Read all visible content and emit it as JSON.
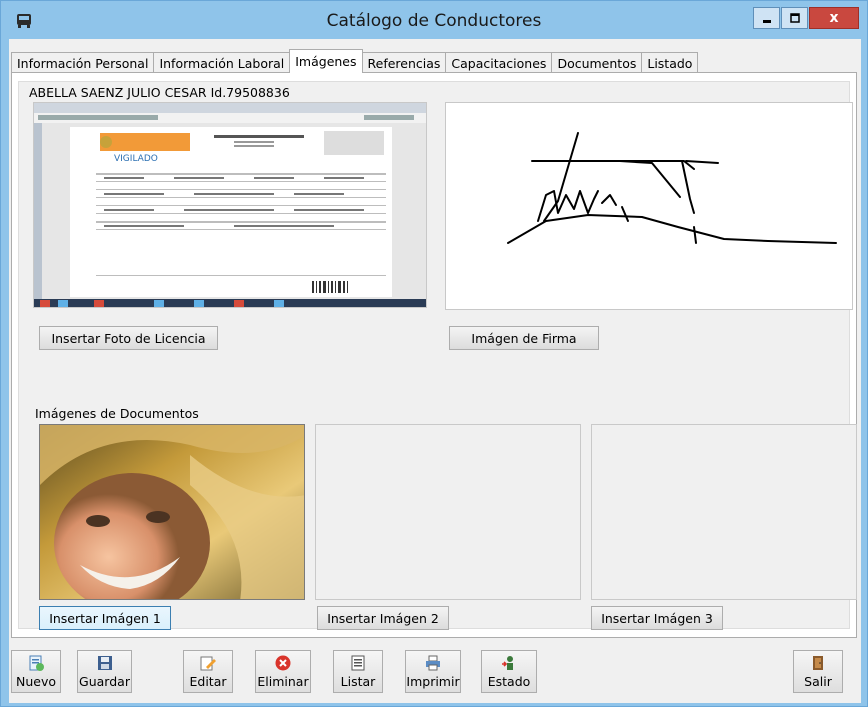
{
  "window": {
    "title": "Catálogo de Conductores",
    "close_glyph": "x"
  },
  "tabs": [
    {
      "label": "Información Personal"
    },
    {
      "label": "Información Laboral"
    },
    {
      "label": "Imágenes",
      "active": true
    },
    {
      "label": "Referencias"
    },
    {
      "label": "Capacitaciones"
    },
    {
      "label": "Documentos"
    },
    {
      "label": "Listado"
    }
  ],
  "images_tab": {
    "driver_heading": "ABELLA SAENZ JULIO CESAR Id.79508836",
    "license_button": "Insertar Foto de Licencia",
    "signature_button": "Imágen de Firma",
    "documents_label": "Imágenes de Documentos",
    "doc_buttons": [
      "Insertar Imágen 1",
      "Insertar Imágen 2",
      "Insertar Imágen 3"
    ]
  },
  "toolbar": {
    "nuevo": "Nuevo",
    "guardar": "Guardar",
    "editar": "Editar",
    "eliminar": "Eliminar",
    "listar": "Listar",
    "imprimir": "Imprimir",
    "estado": "Estado",
    "salir": "Salir"
  },
  "icons": {
    "app": "bus-icon",
    "nuevo": "new-document-icon",
    "guardar": "floppy-disk-icon",
    "editar": "edit-icon",
    "eliminar": "delete-circle-icon",
    "listar": "list-icon",
    "imprimir": "printer-icon",
    "estado": "status-person-icon",
    "salir": "exit-door-icon"
  },
  "colors": {
    "titlebar": "#8fc4ea",
    "close_button": "#c9483f",
    "panel_background": "#f0f0f0"
  }
}
